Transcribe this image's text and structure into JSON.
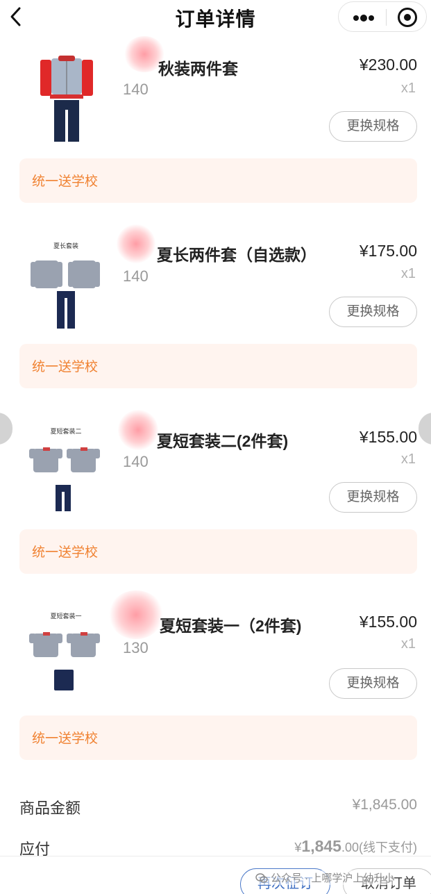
{
  "header": {
    "title": "订单详情",
    "back_icon": "chevron-left-icon",
    "more_icon": "more-dots-icon",
    "close_icon": "miniprogram-close-icon"
  },
  "items": [
    {
      "name": "秋装两件套",
      "size": "140",
      "price": "¥230.00",
      "qty": "x1",
      "spec_button": "更换规格",
      "shipping": "统一送学校",
      "thumb_label": ""
    },
    {
      "name": "夏长两件套（自选款）",
      "size": "140",
      "price": "¥175.00",
      "qty": "x1",
      "spec_button": "更换规格",
      "shipping": "统一送学校",
      "thumb_label": "夏长套装"
    },
    {
      "name": "夏短套装二(2件套)",
      "size": "140",
      "price": "¥155.00",
      "qty": "x1",
      "spec_button": "更换规格",
      "shipping": "统一送学校",
      "thumb_label": "夏短套装二"
    },
    {
      "name": "夏短套装一（2件套)",
      "size": "130",
      "price": "¥155.00",
      "qty": "x1",
      "spec_button": "更换规格",
      "shipping": "统一送学校",
      "thumb_label": "夏短套装一"
    }
  ],
  "summary": {
    "goods_label": "商品金额",
    "goods_value": "¥1,845.00",
    "payable_label": "应付",
    "payable_yen": "¥",
    "payable_int": "1,845",
    "payable_dec": ".00",
    "payable_note": "(线下支付)"
  },
  "actions": {
    "reorder": "再次征订",
    "cancel": "取消订单"
  },
  "watermark": "公众号 · 上哪学沪上幼升小",
  "colors": {
    "accent_orange": "#f08232",
    "shipping_bg": "#fff4ef",
    "reorder_blue": "#3f6fc2"
  }
}
